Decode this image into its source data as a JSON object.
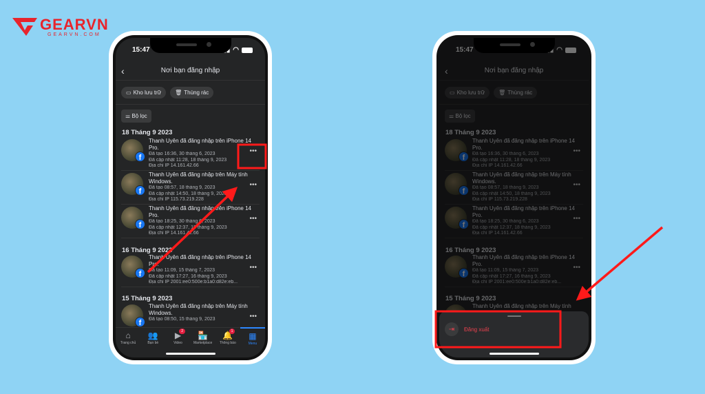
{
  "brand": {
    "name": "GEARVN",
    "url": "GEARVN.COM",
    "color": "#e8242c"
  },
  "status": {
    "time": "15:47"
  },
  "header": {
    "title": "Nơi bạn đăng nhập",
    "back_icon": "chevron-left-icon"
  },
  "chips": [
    {
      "label": "Kho lưu trữ",
      "icon": "archive-icon"
    },
    {
      "label": "Thùng rác",
      "icon": "trash-icon"
    }
  ],
  "filter_label": "Bộ lọc",
  "groups": [
    {
      "date": "18 Tháng 9 2023",
      "items": [
        {
          "title": "Thanh Uyên đã đăng nhập trên iPhone 14 Pro.",
          "created": "Đã tạo 16:36, 30 tháng 6, 2023",
          "updated": "Đã cập nhật 11:28, 18 tháng 9, 2023",
          "ip": "Địa chỉ IP 14.161.42.66"
        },
        {
          "title": "Thanh Uyên đã đăng nhập trên Máy tính Windows.",
          "created": "Đã tạo 08:57, 18 tháng 9, 2023",
          "updated": "Đã cập nhật 14:50, 18 tháng 9, 2023",
          "ip": "Địa chỉ IP 115.73.219.228"
        },
        {
          "title": "Thanh Uyên đã đăng nhập trên iPhone 14 Pro.",
          "created": "Đã tạo 18:25, 30 tháng 6, 2023",
          "updated": "Đã cập nhật 12:37, 18 tháng 9, 2023",
          "ip": "Địa chỉ IP 14.161.42.66"
        }
      ]
    },
    {
      "date": "16 Tháng 9 2023",
      "items": [
        {
          "title": "Thanh Uyên đã đăng nhập trên iPhone 14 Pro.",
          "created": "Đã tạo 11:09, 15 tháng 7, 2023",
          "updated": "Đã cập nhật 17:27, 16 tháng 9, 2023",
          "ip": "Địa chỉ IP 2001:ee0:500e:b1a0:d82e:eb..."
        }
      ]
    },
    {
      "date": "15 Tháng 9 2023",
      "items": [
        {
          "title": "Thanh Uyên đã đăng nhập trên Máy tính Windows.",
          "created": "Đã tạo 08:50, 15 tháng 9, 2023",
          "updated": "",
          "ip": ""
        }
      ]
    }
  ],
  "nav": [
    {
      "label": "Trang chủ",
      "icon": "home-icon",
      "glyph": "⌂"
    },
    {
      "label": "Bạn bè",
      "icon": "friends-icon",
      "glyph": "👥"
    },
    {
      "label": "Video",
      "icon": "video-icon",
      "glyph": "▶",
      "badge": "2"
    },
    {
      "label": "Marketplace",
      "icon": "marketplace-icon",
      "glyph": "🏪"
    },
    {
      "label": "Thông báo",
      "icon": "bell-icon",
      "glyph": "🔔",
      "badge": "1"
    },
    {
      "label": "Menu",
      "icon": "menu-grid-icon",
      "glyph": "▦",
      "active": true
    }
  ],
  "sheet": {
    "logout_label": "Đăng xuất",
    "logout_icon": "logout-icon"
  },
  "annotation_color": "#ff1a1a"
}
